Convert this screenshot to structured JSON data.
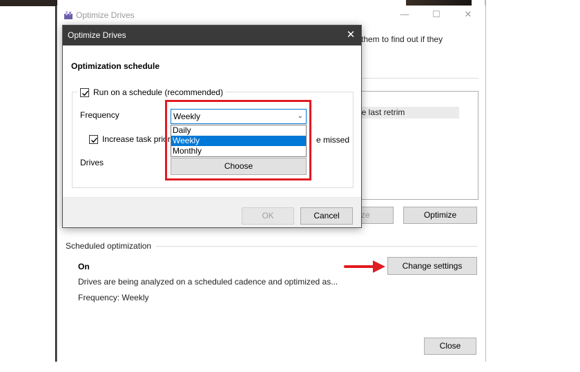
{
  "main_window": {
    "title": "Optimize Drives",
    "description": "them to find out if they",
    "list_row": "nce last retrim",
    "partial_button": "ze",
    "optimize_button": "Optimize",
    "scheduled_section_label": "Scheduled optimization",
    "schedule_state": "On",
    "schedule_description": "Drives are being analyzed on a scheduled cadence and optimized as...",
    "frequency_line": "Frequency: Weekly",
    "change_settings_button": "Change settings",
    "close_button": "Close",
    "window_controls": {
      "minimize": "—",
      "maximize": "☐",
      "close": "✕"
    }
  },
  "dialog": {
    "title": "Optimize Drives",
    "close_glyph": "✕",
    "heading": "Optimization schedule",
    "run_on_schedule": {
      "label": "Run on a schedule (recommended)",
      "checked": true
    },
    "frequency_label": "Frequency",
    "frequency_select": {
      "value": "Weekly",
      "options": [
        "Daily",
        "Weekly",
        "Monthly"
      ],
      "highlighted": "Weekly"
    },
    "increase_priority": {
      "label": "Increase task priori",
      "suffix": "e missed",
      "checked": true
    },
    "drives_label": "Drives",
    "choose_button": "Choose",
    "ok_button": "OK",
    "cancel_button": "Cancel"
  },
  "colors": {
    "highlight_box": "#e11b22",
    "selection_blue": "#0078d7",
    "dialog_titlebar": "#3a3a3a",
    "arrow": "#e11b22"
  }
}
